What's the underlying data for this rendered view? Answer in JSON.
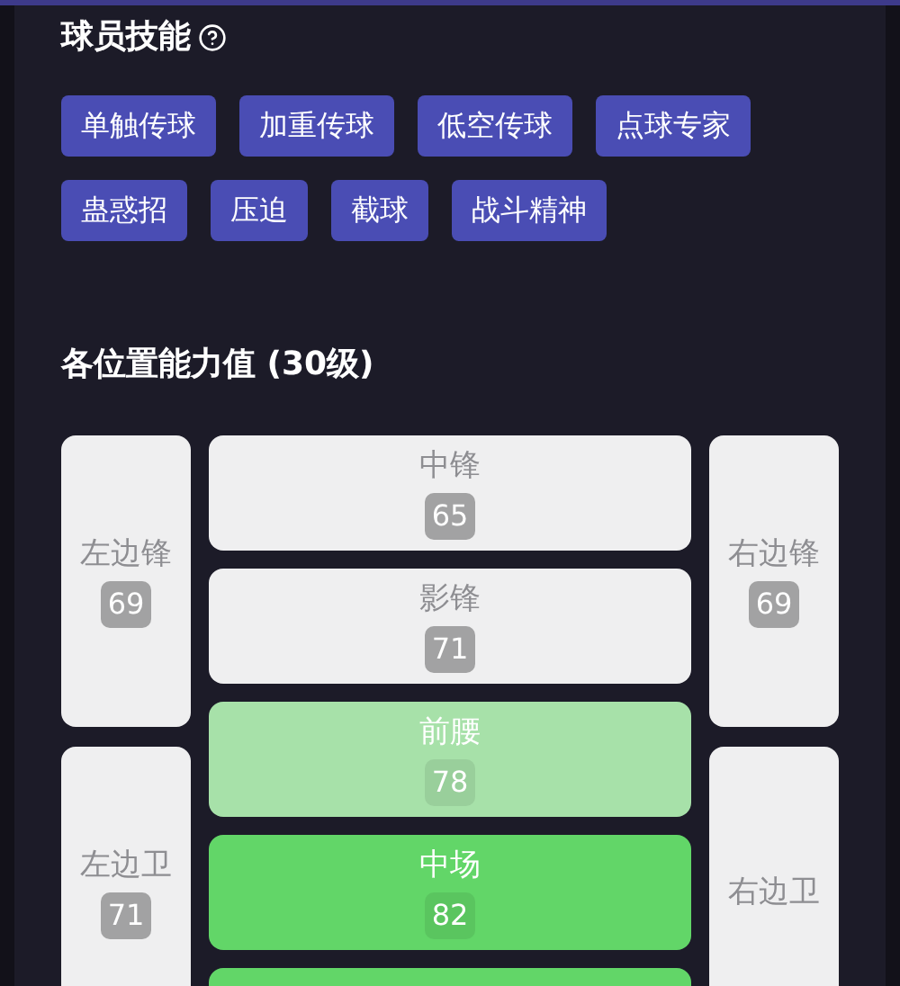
{
  "skills": {
    "title": "球员技能",
    "tags": [
      "单触传球",
      "加重传球",
      "低空传球",
      "点球专家",
      "蛊惑招",
      "压迫",
      "截球",
      "战斗精神"
    ]
  },
  "positions": {
    "title": "各位置能力值 (30级)",
    "left": [
      {
        "name": "左边锋",
        "value": "69",
        "color": "#efeff0"
      },
      {
        "name": "左边卫",
        "value": "71",
        "color": "#efeff0"
      }
    ],
    "center": [
      {
        "name": "中锋",
        "value": "65",
        "color": "#efeff0"
      },
      {
        "name": "影锋",
        "value": "71",
        "color": "#efeff0"
      },
      {
        "name": "前腰",
        "value": "78",
        "color": "#a7e1a9"
      },
      {
        "name": "中场",
        "value": "82",
        "color": "#62d668"
      },
      {
        "color": "#62d668"
      }
    ],
    "right": [
      {
        "name": "右边锋",
        "value": "69",
        "color": "#efeff0"
      },
      {
        "name": "右边卫",
        "color": "#efeff0"
      }
    ]
  }
}
